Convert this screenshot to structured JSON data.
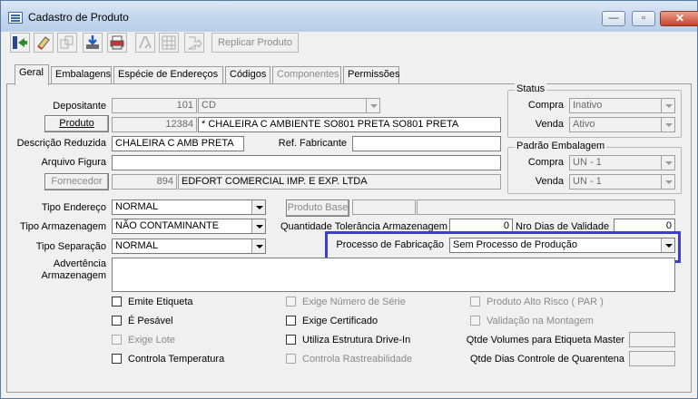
{
  "window": {
    "title": "Cadastro de Produto",
    "controls": {
      "minimize": "—",
      "maximize": "▫",
      "close": "✕"
    }
  },
  "toolbar": {
    "icons": [
      "enter-icon",
      "eraser-icon",
      "copy-icon",
      "download-icon",
      "printer-icon",
      "validate-icon",
      "grid-icon",
      "link-icon"
    ],
    "replicate_label": "Replicar Produto"
  },
  "tabs": [
    {
      "label": "Geral",
      "active": true,
      "enabled": true
    },
    {
      "label": "Embalagens",
      "active": false,
      "enabled": true
    },
    {
      "label": "Espécie de Endereços",
      "active": false,
      "enabled": true
    },
    {
      "label": "Códigos",
      "active": false,
      "enabled": true
    },
    {
      "label": "Componentes",
      "active": false,
      "enabled": false
    },
    {
      "label": "Permissões",
      "active": false,
      "enabled": true
    }
  ],
  "form": {
    "depositante_label": "Depositante",
    "depositante_code": "101",
    "depositante_name": "CD",
    "produto_button": "Produto",
    "produto_code": "12384",
    "produto_desc": "* CHALEIRA C AMBIENTE SO801 PRETA SO801 PRETA",
    "descricao_reduzida_label": "Descrição Reduzida",
    "descricao_reduzida_value": "CHALEIRA C AMB PRETA",
    "ref_fabricante_label": "Ref. Fabricante",
    "ref_fabricante_value": "",
    "arquivo_figura_label": "Arquivo Figura",
    "arquivo_figura_value": "",
    "fornecedor_button": "Fornecedor",
    "fornecedor_code": "894",
    "fornecedor_name": "EDFORT COMERCIAL IMP. E EXP. LTDA",
    "tipo_endereco_label": "Tipo Endereço",
    "tipo_endereco_value": "NORMAL",
    "tipo_armazenagem_label": "Tipo Armazenagem",
    "tipo_armazenagem_value": "NÃO CONTAMINANTE",
    "tipo_separacao_label": "Tipo Separação",
    "tipo_separacao_value": "NORMAL",
    "produto_base_button": "Produto Base",
    "qtd_tolerancia_label": "Quantidade Tolerância Armazenagem",
    "qtd_tolerancia_value": "0",
    "nro_dias_validade_label": "Nro Dias de Validade",
    "nro_dias_validade_value": "0",
    "processo_fabricacao_label": "Processo de Fabricação",
    "processo_fabricacao_value": "Sem Processo de Produção",
    "advertencia_label_1": "Advertência",
    "advertencia_label_2": "Armazenagem"
  },
  "status": {
    "title": "Status",
    "compra_label": "Compra",
    "compra_value": "Inativo",
    "venda_label": "Venda",
    "venda_value": "Ativo"
  },
  "padrao_embalagem": {
    "title": "Padrão Embalagem",
    "compra_label": "Compra",
    "compra_value": "UN - 1",
    "venda_label": "Venda",
    "venda_value": "UN - 1"
  },
  "checkboxes": {
    "emite_etiqueta": "Emite Etiqueta",
    "e_pesavel": "É Pesável",
    "exige_lote": "Exige Lote",
    "controla_temperatura": "Controla Temperatura",
    "exige_numero_serie": "Exige Número de Série",
    "exige_certificado": "Exige Certificado",
    "utiliza_estrutura": "Utiliza Estrutura Drive-In",
    "controla_rastreabilidade": "Controla Rastreabilidade",
    "produto_alto_risco": "Produto Alto Risco ( PAR )",
    "validacao_montagem": "Validação na Montagem"
  },
  "extra": {
    "qtde_volumes_label": "Qtde Volumes para Etiqueta Master",
    "qtde_volumes_value": "",
    "qtde_dias_quarentena_label": "Qtde Dias Controle de Quarentena",
    "qtde_dias_quarentena_value": ""
  },
  "colors": {
    "highlight": "#3b3fd0",
    "window_border": "#5a7aa6",
    "close_button": "#c8422c"
  }
}
